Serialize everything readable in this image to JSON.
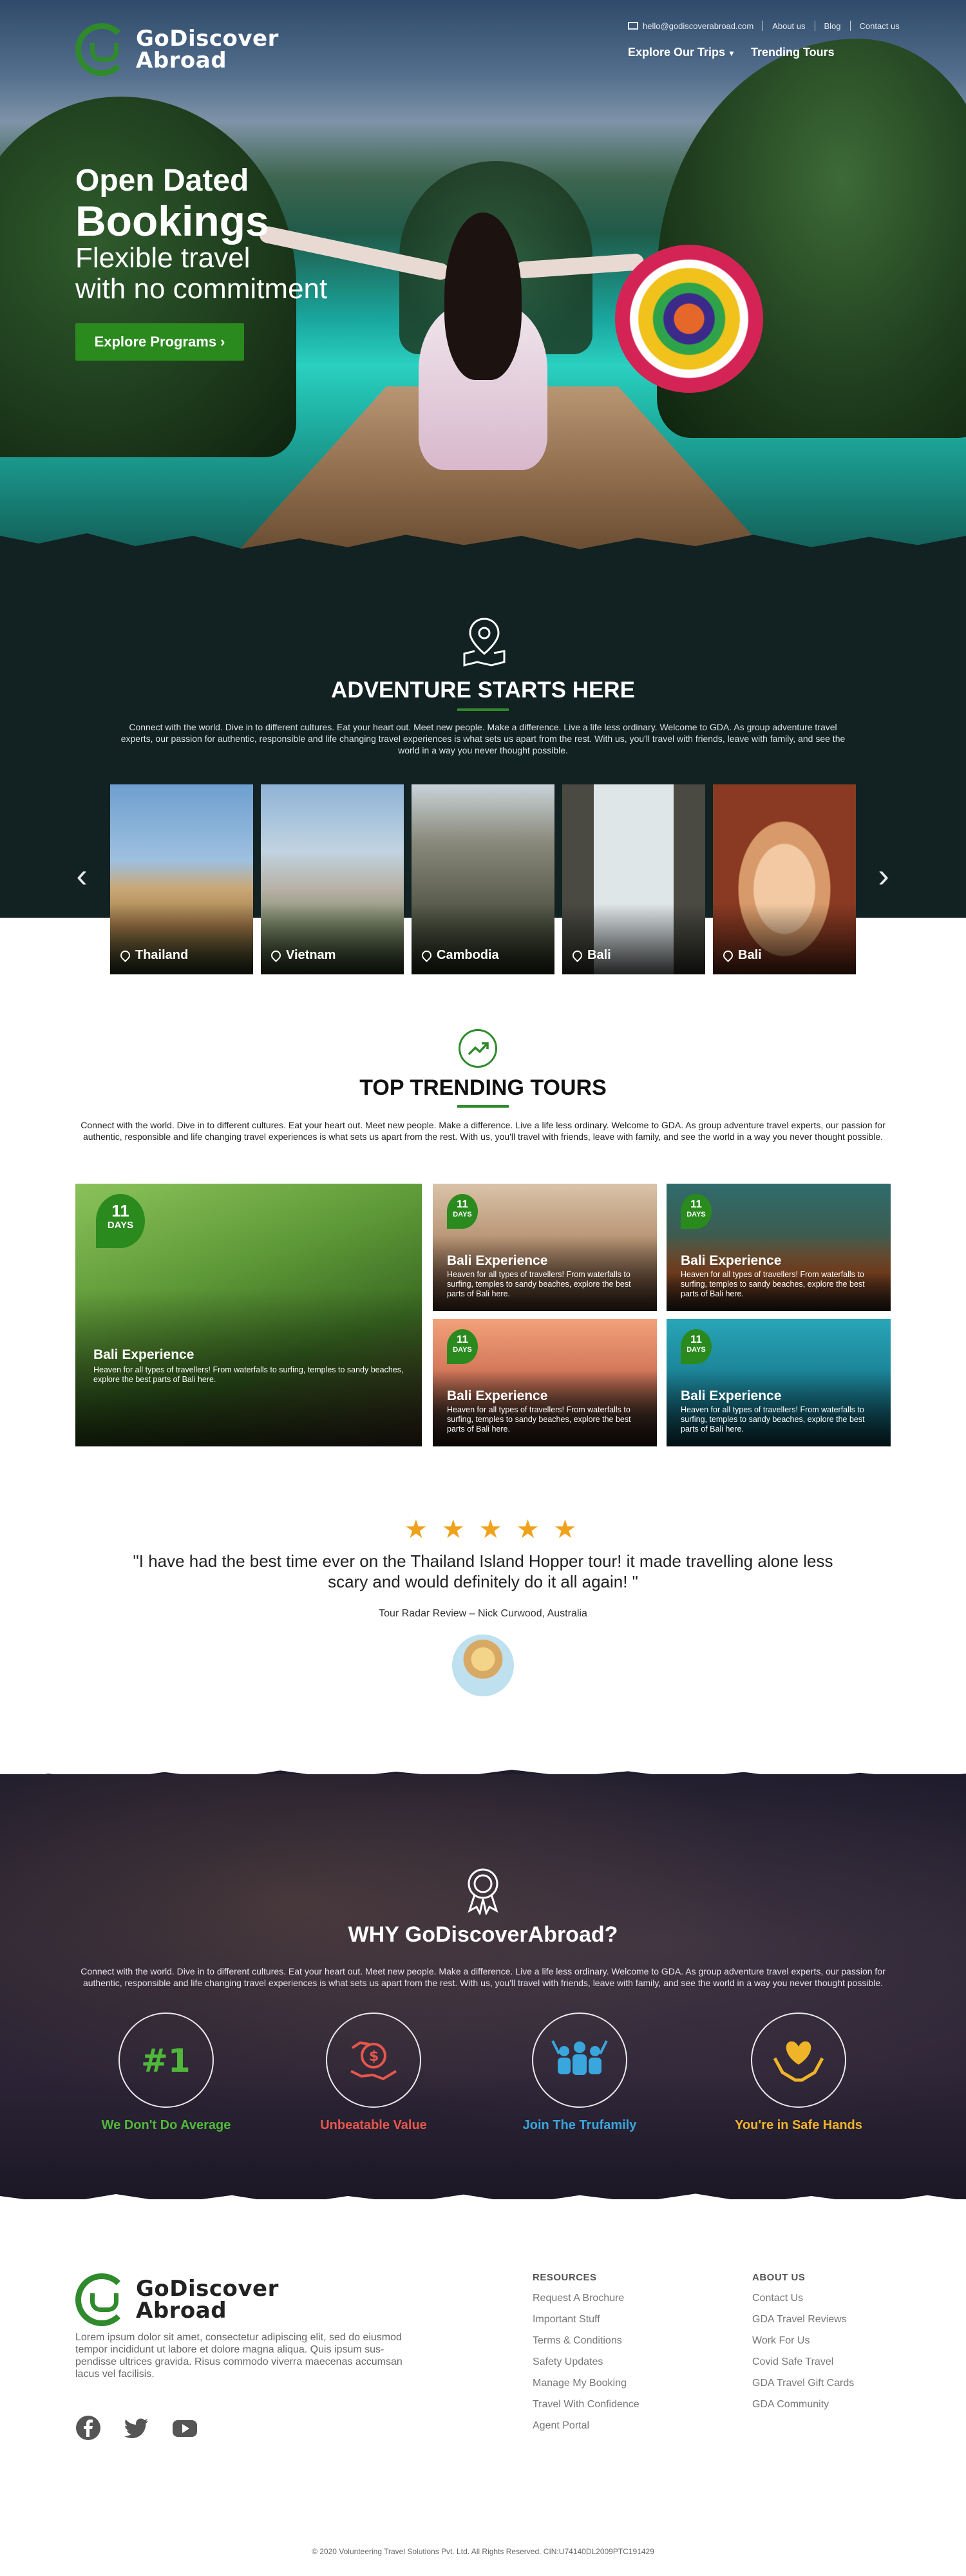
{
  "brand": {
    "name_line1": "GoDiscover",
    "name_line2": "Abroad",
    "green": "#2f8a2c"
  },
  "topbar": {
    "email": "hello@godiscoverabroad.com",
    "about": "About us",
    "blog": "Blog",
    "contact": "Contact us"
  },
  "nav": {
    "explore": "Explore Our Trips",
    "trending": "Trending Tours"
  },
  "hero": {
    "line1": "Open Dated",
    "line2": "Bookings",
    "line3": "Flexible travel",
    "line4": "with no commitment",
    "cta": "Explore Programs"
  },
  "adventure": {
    "title": "ADVENTURE STARTS HERE",
    "text": "Connect with the world. Dive in to different cultures. Eat your heart out. Meet new people. Make a difference. Live a life less ordinary. Welcome to GDA. As group adventure travel experts, our passion for authentic, responsible and life changing travel experiences is what sets us apart from the rest. With us, you'll travel with friends, leave with family, and see the world in a way you never thought possible.",
    "prev_icon": "chevron-left-icon",
    "next_icon": "chevron-right-icon",
    "destinations": [
      "Thailand",
      "Vietnam",
      "Cambodia",
      "Bali",
      "Bali"
    ]
  },
  "trending": {
    "title": "TOP TRENDING TOURS",
    "text": "Connect with the world. Dive in to different cultures. Eat your heart out. Meet new people. Make a difference. Live a life less ordinary. Welcome to GDA. As group adventure travel experts, our passion for authentic, responsible and life changing travel experiences is what sets us apart from the rest. With us, you'll travel with friends, leave with family, and see the world in a way you never thought possible.",
    "tours": [
      {
        "days": "11",
        "unit": "DAYS",
        "title": "Bali Experience",
        "desc": "Heaven for all types of travellers! From waterfalls to surfing, temples to sandy beaches, explore the best parts of Bali here."
      },
      {
        "days": "11",
        "unit": "DAYS",
        "title": "Bali Experience",
        "desc": "Heaven for all types of travellers! From waterfalls to surfing, temples to sandy beaches, explore the best parts of Bali here."
      },
      {
        "days": "11",
        "unit": "DAYS",
        "title": "Bali Experience",
        "desc": "Heaven for all types of travellers! From waterfalls to surfing, temples to sandy beaches, explore the best parts of Bali here."
      },
      {
        "days": "11",
        "unit": "DAYS",
        "title": "Bali Experience",
        "desc": "Heaven for all types of travellers! From waterfalls to surfing, temples to sandy beaches, explore the best parts of Bali here."
      },
      {
        "days": "11",
        "unit": "DAYS",
        "title": "Bali Experience",
        "desc": "Heaven for all types of travellers! From waterfalls to surfing, temples to sandy beaches, explore the best parts of Bali here."
      }
    ]
  },
  "testimonial": {
    "rating": 5,
    "star": "★",
    "quote": "\"I have had the best time ever on the Thailand Island Hopper tour! it made travelling alone less scary and would definitely do it all again! \"",
    "source": "Tour Radar Review – Nick Curwood, Australia"
  },
  "why": {
    "title": "WHY GoDiscoverAbroad?",
    "text": "Connect with the world. Dive in to different cultures. Eat your heart out. Meet new people. Make a difference. Live a life less ordinary. Welcome to GDA. As group adventure travel experts, our passion for authentic, responsible and life changing travel experiences is what sets us apart from the rest. With us, you'll travel with friends, leave with family, and see the world in a way you never thought possible.",
    "features": [
      {
        "label": "We Don't Do Average",
        "color": "#4fb83a",
        "icon": "number-one-icon"
      },
      {
        "label": "Unbeatable Value",
        "color": "#e6574c",
        "icon": "money-hands-icon"
      },
      {
        "label": "Join The Trufamily",
        "color": "#3aa6de",
        "icon": "group-icon"
      },
      {
        "label": "You're in Safe Hands",
        "color": "#f0b429",
        "icon": "heart-hands-icon"
      }
    ]
  },
  "footer": {
    "about": "Lorem ipsum dolor sit amet, consectetur adipiscing elit, sed do eiusmod tempor incididunt ut labore et dolore magna aliqua. Quis ipsum sus-pendisse ultrices gravida. Risus commodo viverra maecenas accumsan lacus vel facilisis.",
    "resources_title": "RESOURCES",
    "resources": [
      "Request A Brochure",
      "Important Stuff",
      "Terms & Conditions",
      "Safety Updates",
      "Manage My Booking",
      "Travel With Confidence",
      "Agent Portal"
    ],
    "about_title": "ABOUT US",
    "about_links": [
      "Contact Us",
      "GDA Travel Reviews",
      "Work For Us",
      "Covid Safe Travel",
      "GDA Travel Gift Cards",
      "GDA Community"
    ],
    "social": [
      "facebook-icon",
      "twitter-icon",
      "youtube-icon"
    ],
    "copyright": "© 2020 Volunteering Travel Solutions Pvt. Ltd. All Rights Reserved. CIN:U74140DL2009PTC191429"
  }
}
